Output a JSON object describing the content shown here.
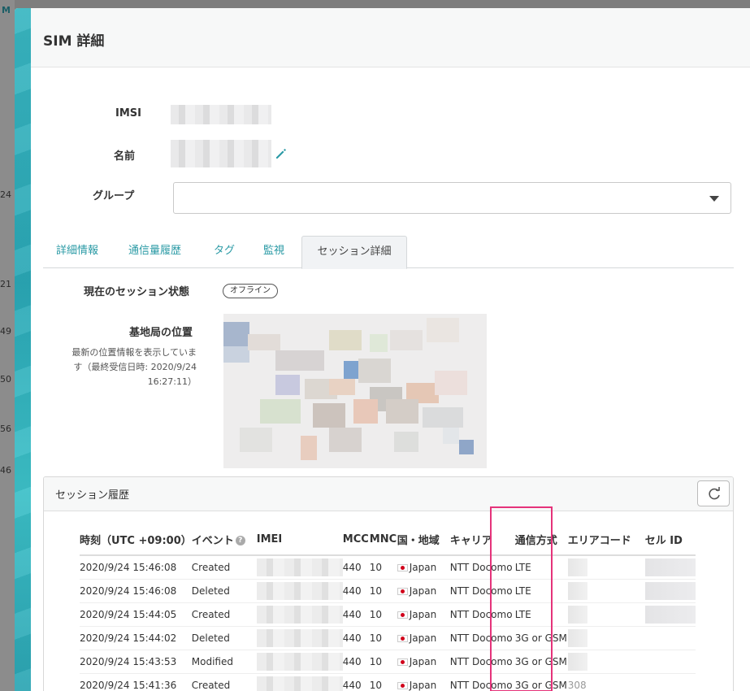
{
  "modal": {
    "title": "SIM 詳細"
  },
  "fields": {
    "imsi_label": "IMSI",
    "name_label": "名前",
    "group_label": "グループ",
    "group_value": ""
  },
  "tabs": [
    {
      "label": "詳細情報"
    },
    {
      "label": "通信量履歴"
    },
    {
      "label": "タグ"
    },
    {
      "label": "監視"
    },
    {
      "label": "セッション詳細"
    }
  ],
  "session": {
    "status_label": "現在のセッション状態",
    "status_value": "オフライン",
    "location_label": "基地局の位置",
    "location_desc_1": "最新の位置情報を表示していま",
    "location_desc_2": "す（最終受信日時: 2020/9/24",
    "location_desc_3": "16:27:11）"
  },
  "history": {
    "title": "セッション履歴",
    "columns": [
      "時刻（UTC +09:00）",
      "イベント",
      "IMEI",
      "MCC",
      "MNC",
      "国・地域",
      "キャリア",
      "通信方式",
      "エリアコード",
      "セル ID"
    ],
    "rows": [
      {
        "time": "2020/9/24 15:46:08",
        "event": "Created",
        "mcc": "440",
        "mnc": "10",
        "country": "Japan",
        "carrier": "NTT Docomo",
        "rat": "LTE"
      },
      {
        "time": "2020/9/24 15:46:08",
        "event": "Deleted",
        "mcc": "440",
        "mnc": "10",
        "country": "Japan",
        "carrier": "NTT Docomo",
        "rat": "LTE"
      },
      {
        "time": "2020/9/24 15:44:05",
        "event": "Created",
        "mcc": "440",
        "mnc": "10",
        "country": "Japan",
        "carrier": "NTT Docomo",
        "rat": "LTE"
      },
      {
        "time": "2020/9/24 15:44:02",
        "event": "Deleted",
        "mcc": "440",
        "mnc": "10",
        "country": "Japan",
        "carrier": "NTT Docomo",
        "rat": "3G or GSM"
      },
      {
        "time": "2020/9/24 15:43:53",
        "event": "Modified",
        "mcc": "440",
        "mnc": "10",
        "country": "Japan",
        "carrier": "NTT Docomo",
        "rat": "3G or GSM"
      },
      {
        "time": "2020/9/24 15:41:36",
        "event": "Created",
        "mcc": "440",
        "mnc": "10",
        "country": "Japan",
        "carrier": "NTT Docomo",
        "rat": "3G or GSM",
        "area": "308"
      }
    ]
  },
  "background": {
    "m": "M",
    "n24": "24",
    "n21": "21",
    "n49": "49",
    "n50": "50",
    "n56": "56",
    "n46": "46"
  },
  "colors": {
    "accent": "#2a9aa5",
    "highlight": "#e5337a",
    "teal_bar": "#2aa7b5"
  }
}
